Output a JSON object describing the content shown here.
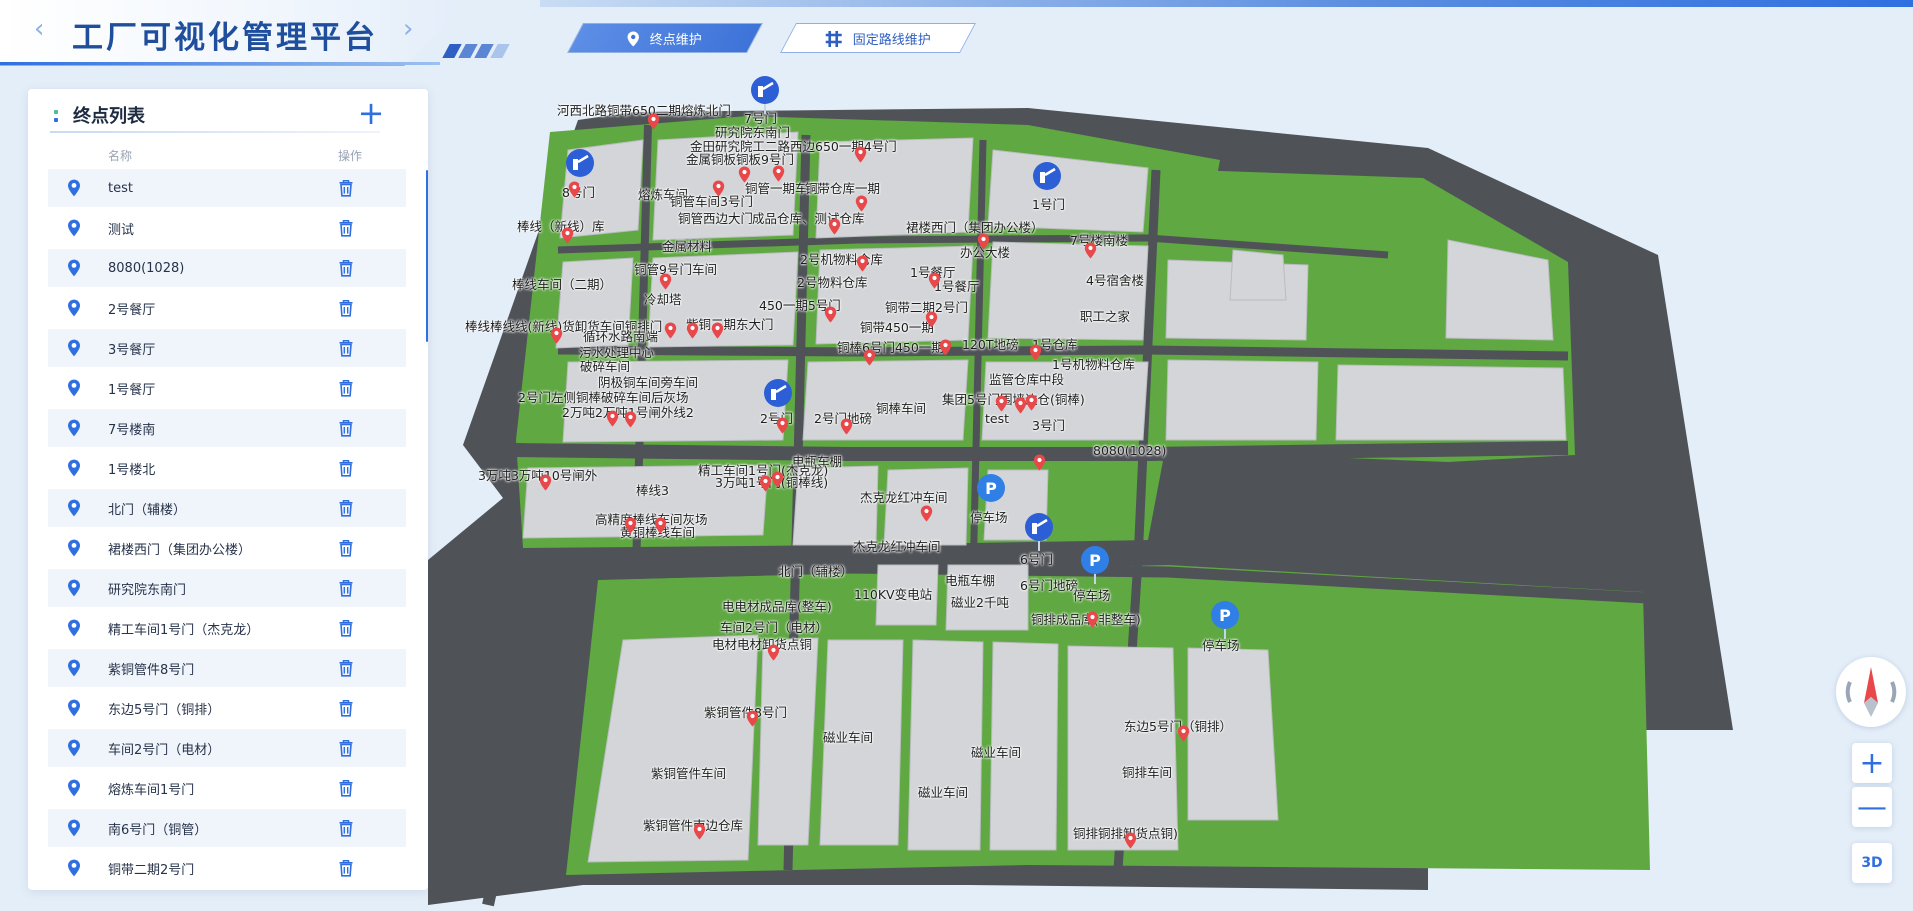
{
  "app": {
    "title": "工厂可视化管理平台"
  },
  "nav": {
    "tabs": [
      {
        "label": "终点维护",
        "icon": "location-pin-icon",
        "active": true
      },
      {
        "label": "固定路线维护",
        "icon": "hash-grid-icon",
        "active": false
      }
    ]
  },
  "panel": {
    "title": "终点列表",
    "add_label": "+",
    "columns": {
      "name": "名称",
      "ops": "操作"
    },
    "items": [
      "test",
      "测试",
      "8080(1028)",
      "2号餐厅",
      "3号餐厅",
      "1号餐厅",
      "7号楼南",
      "1号楼北",
      "北门（辅楼）",
      "裙楼西门（集团办公楼）",
      "研究院东南门",
      "精工车间1号门（杰克龙）",
      "紫铜管件8号门",
      "东边5号门（铜排）",
      "车间2号门（电材）",
      "熔炼车间1号门",
      "南6号门（铜管）",
      "铜带二期2号门"
    ]
  },
  "map": {
    "labels": [
      {
        "t": "河西北路铜带650二期熔炼北门"
      },
      {
        "t": "7号门"
      },
      {
        "t": "研究院东南门"
      },
      {
        "t": "金田研究院工二路西边650一期4号门"
      },
      {
        "t": "金属铜板铜板9号门"
      },
      {
        "t": "8号门"
      },
      {
        "t": "熔炼车间"
      },
      {
        "t": "铜管车间3号门"
      },
      {
        "t": "铜管一期车间"
      },
      {
        "t": "铜带仓库一期"
      },
      {
        "t": "1号门"
      },
      {
        "t": "棒线（新线）库"
      },
      {
        "t": "铜管西边大门"
      },
      {
        "t": "成品仓库、测试仓库"
      },
      {
        "t": "裙楼西门（集团办公楼）"
      },
      {
        "t": "7号楼南楼"
      },
      {
        "t": "金属材料"
      },
      {
        "t": "办公大楼"
      },
      {
        "t": "2号机物料仓库"
      },
      {
        "t": "铜管9号门车间"
      },
      {
        "t": "1号餐厅"
      },
      {
        "t": "4号宿舍楼"
      },
      {
        "t": "棒线车间（二期）"
      },
      {
        "t": "2号物料仓库"
      },
      {
        "t": "1号餐厅"
      },
      {
        "t": "冷却塔"
      },
      {
        "t": "450一期5号门"
      },
      {
        "t": "铜带二期2号门"
      },
      {
        "t": "职工之家"
      },
      {
        "t": "棒线棒线线(新线)货卸货车间铜排门"
      },
      {
        "t": "紫铜三期东大门"
      },
      {
        "t": "铜带450一期"
      },
      {
        "t": "循环水路南端"
      },
      {
        "t": "铜棒6号门450一期"
      },
      {
        "t": "120T地磅"
      },
      {
        "t": "1号仓库"
      },
      {
        "t": "污水处理中心"
      },
      {
        "t": "1号机物料仓库"
      },
      {
        "t": "破碎车间"
      },
      {
        "t": "阴极铜车间旁车间"
      },
      {
        "t": "监管仓库中段"
      },
      {
        "t": "2号门左侧铜棒破碎车间后灰场"
      },
      {
        "t": "集团5号门围墙边仓(铜棒)"
      },
      {
        "t": "铜棒车间"
      },
      {
        "t": "2万吨2万吨1号闸外线2"
      },
      {
        "t": "2号门"
      },
      {
        "t": "2号门地磅"
      },
      {
        "t": "test"
      },
      {
        "t": "3号门"
      },
      {
        "t": "电瓶车棚"
      },
      {
        "t": "8080(1028)"
      },
      {
        "t": "精工车间1号门(杰克龙)"
      },
      {
        "t": "3万吨3万吨10号闸外"
      },
      {
        "t": "3万吨1号门(铜棒线)"
      },
      {
        "t": "棒线3"
      },
      {
        "t": "杰克龙红冲车间"
      },
      {
        "t": "停车场"
      },
      {
        "t": "高精度棒线车间灰场"
      },
      {
        "t": "黄铜棒线车间"
      },
      {
        "t": "杰克龙红冲车间"
      },
      {
        "t": "6号门"
      },
      {
        "t": "北门（辅楼）"
      },
      {
        "t": "电瓶车棚"
      },
      {
        "t": "6号门地磅"
      },
      {
        "t": "停车场"
      },
      {
        "t": "110KV变电站"
      },
      {
        "t": "磁业2千吨"
      },
      {
        "t": "电电材成品库(整车)"
      },
      {
        "t": "铜排成品库(非整车)"
      },
      {
        "t": "停车场"
      },
      {
        "t": "车间2号门（电材）"
      },
      {
        "t": "电材电材卸货点铜"
      },
      {
        "t": "紫铜管件8号门"
      },
      {
        "t": "东边5号门（铜排）"
      },
      {
        "t": "磁业车间"
      },
      {
        "t": "磁业车间"
      },
      {
        "t": "紫铜管件车间"
      },
      {
        "t": "铜排车间"
      },
      {
        "t": "磁业车间"
      },
      {
        "t": "紫铜管件南边仓库"
      },
      {
        "t": "铜排铜排卸货点铜)"
      }
    ]
  },
  "controls": {
    "compass": "compass-icon",
    "zoom_in": "+",
    "zoom_out": "—",
    "mode": "3D"
  },
  "colors": {
    "accent": "#2f6fe0",
    "marker": "#e8484a",
    "grass": "#5fa842",
    "building": "#d3d5d8",
    "road": "#4f5257"
  }
}
